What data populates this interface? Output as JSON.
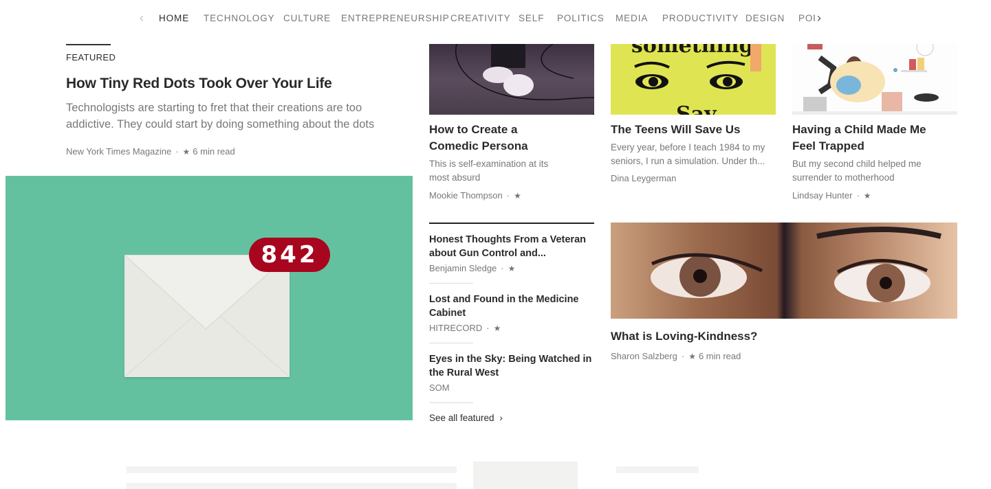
{
  "nav": {
    "prev_icon": "chevron-left-icon",
    "next_icon": "chevron-right-icon",
    "items": [
      {
        "label": "HOME",
        "active": true
      },
      {
        "label": "TECHNOLOGY"
      },
      {
        "label": "CULTURE"
      },
      {
        "label": "ENTREPRENEURSHIP"
      },
      {
        "label": "CREATIVITY"
      },
      {
        "label": "SELF"
      },
      {
        "label": "POLITICS"
      },
      {
        "label": "MEDIA"
      },
      {
        "label": "PRODUCTIVITY"
      },
      {
        "label": "DESIGN"
      },
      {
        "label": "POPULAR"
      }
    ]
  },
  "featured": {
    "label": "FEATURED",
    "title": "How Tiny Red Dots Took Over Your Life",
    "subtitle": "Technologists are starting to fret that their creations are too addictive. They could start by doing something about the dots",
    "author": "New York Times Magazine",
    "read_time": "6 min read",
    "image": {
      "description": "envelope with red notification badge",
      "badge_count": "842",
      "bg_color": "#64c1a0",
      "badge_color": "#a8051f"
    }
  },
  "cards": [
    {
      "title": "How to Create a Comedic Persona",
      "subtitle": "This is self-examination at its most absurd",
      "author": "Mookie Thompson",
      "image": "white sneakers on stage"
    },
    {
      "title": "The Teens Will Save Us",
      "subtitle": "Every year, before I teach 1984 to my seniors, I run a simulation. Under th...",
      "author": "Dina Leygerman",
      "image": "yellow poster with eyes",
      "poster_text_top": "something,",
      "poster_text_bottom": "Say"
    },
    {
      "title": "Having a Child Made Me Feel Trapped",
      "subtitle": "But my second child helped me surrender to motherhood",
      "author": "Lindsay Hunter",
      "image": "illustration of multitasking mother"
    }
  ],
  "list": [
    {
      "title": "Honest Thoughts From a Veteran about Gun Control and...",
      "author": "Benjamin Sledge",
      "star": true
    },
    {
      "title": "Lost and Found in the Medicine Cabinet",
      "author": "HITRECORD",
      "star": true
    },
    {
      "title": "Eyes in the Sky: Being Watched in the Rural West",
      "author": "SOM",
      "star": false
    }
  ],
  "see_all": "See all featured",
  "big_card": {
    "title": "What is Loving-Kindness?",
    "author": "Sharon Salzberg",
    "read_time": "6 min read",
    "image": "two eyes close-up"
  },
  "star_glyph": "★",
  "dot_glyph": "·",
  "chevron_glyph": "›"
}
